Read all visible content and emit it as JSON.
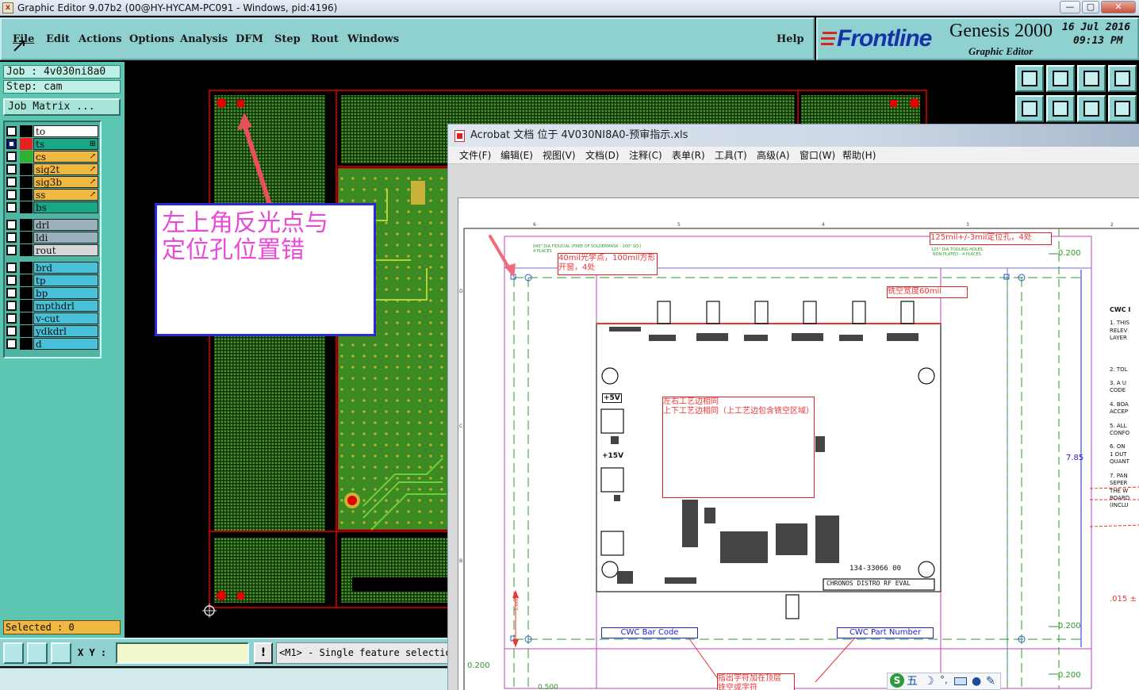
{
  "window": {
    "title": "Graphic Editor 9.07b2 (00@HY-HYCAM-PC091 - Windows, pid:4196)",
    "app_icon": "x-icon",
    "btn_minimize": "—",
    "btn_maximize": "▢",
    "btn_close": "✕"
  },
  "menu": {
    "items": [
      "File",
      "Edit",
      "Actions",
      "Options",
      "Analysis",
      "DFM",
      "Step",
      "Rout",
      "Windows"
    ],
    "help": "Help"
  },
  "logo": {
    "brand_first": "F",
    "brand_rest": "rontline",
    "product": "Genesis 2000",
    "subtitle": "Graphic Editor",
    "date": "16 Jul 2016",
    "time": "09:13 PM"
  },
  "job": {
    "job_label": "Job  : 4v030ni8a0",
    "step_label": "Step: cam",
    "matrix_button": "Job Matrix ..."
  },
  "layers": [
    {
      "name": "to",
      "color": "#ffffff",
      "swatch": "#000000",
      "checked": false,
      "mark": ""
    },
    {
      "name": "ts",
      "color": "#18a888",
      "swatch": "#e82020",
      "checked": true,
      "mark": "⊞"
    },
    {
      "name": "cs",
      "color": "#f0b840",
      "swatch": "#30b030",
      "checked": false,
      "mark": "↗"
    },
    {
      "name": "sig2t",
      "color": "#f0b840",
      "swatch": "#000000",
      "checked": false,
      "mark": "↗"
    },
    {
      "name": "sig3b",
      "color": "#f0b840",
      "swatch": "#000000",
      "checked": false,
      "mark": "↗"
    },
    {
      "name": "ss",
      "color": "#f0b840",
      "swatch": "#000000",
      "checked": false,
      "mark": "↗"
    },
    {
      "name": "bs",
      "color": "#18a888",
      "swatch": "#000000",
      "checked": false,
      "mark": ""
    },
    {
      "name": "drl",
      "color": "#9ab0bc",
      "swatch": "#000000",
      "checked": false,
      "mark": ""
    },
    {
      "name": "ldi",
      "color": "#9ab0bc",
      "swatch": "#000000",
      "checked": false,
      "mark": ""
    },
    {
      "name": "rout",
      "color": "#d8d8d8",
      "swatch": "#000000",
      "checked": false,
      "mark": ""
    },
    {
      "name": "brd",
      "color": "#48c0d8",
      "swatch": "#000000",
      "checked": false,
      "mark": ""
    },
    {
      "name": "tp",
      "color": "#48c0d8",
      "swatch": "#000000",
      "checked": false,
      "mark": ""
    },
    {
      "name": "bp",
      "color": "#48c0d8",
      "swatch": "#000000",
      "checked": false,
      "mark": ""
    },
    {
      "name": "mpthdrl",
      "color": "#48c0d8",
      "swatch": "#000000",
      "checked": false,
      "mark": ""
    },
    {
      "name": "v-cut",
      "color": "#48c0d8",
      "swatch": "#000000",
      "checked": false,
      "mark": ""
    },
    {
      "name": "ydkdrl",
      "color": "#48c0d8",
      "swatch": "#000000",
      "checked": false,
      "mark": ""
    },
    {
      "name": "d",
      "color": "#48c0d8",
      "swatch": "#000000",
      "checked": false,
      "mark": ""
    }
  ],
  "selected": "Selected : 0",
  "bottom": {
    "xy_label": "X Y :",
    "xy_value": "",
    "warn": "!",
    "message": "<M1> - Single feature selection"
  },
  "annotation": {
    "line1": "左上角反光点与",
    "line2": "定位孔位置错"
  },
  "acrobat": {
    "title": "Acrobat 文档 位于 4V030NI8A0-预审指示.xls",
    "menu": [
      "文件(F)",
      "编辑(E)",
      "视图(V)",
      "文档(D)",
      "注释(C)",
      "表单(R)",
      "工具(T)",
      "高级(A)",
      "窗口(W)",
      "帮助(H)"
    ]
  },
  "drawing": {
    "note_fiducial": "40mil光学点，100mil方形开窗，4处",
    "note_tooling": "125mil+/-3mil定位孔，4处",
    "note_millslot": "铣空宽度60mil",
    "note_edges": [
      "左右工艺边相同",
      "上下工艺边相同（上工艺边包含铣空区域）"
    ],
    "note_label": "指出字符加在顶层",
    "note_label2": "铣空或字符",
    "fid_small": "040\" DIA FIDUCIAL (FREE OF SOLDERMASK - 100\" SQ.)",
    "fid_small2": "4 PLACES",
    "tool_small": "125\" DIA TOOLING HOLES",
    "tool_small2": "NON PLATED - 4 PLACES",
    "dim_right": "7.85",
    "dim_top": "0.200",
    "dim_bottom1": "0.200",
    "dim_bottom2": "0.200",
    "dim_left": "0.200",
    "dim_left_small": "0.500",
    "dim_v_small": "1.000",
    "tol": ".015 ±",
    "board_id": "134-33066 00",
    "board_name": "CHRONOS DISTRO RF EVAL",
    "barcode": "CWC Bar Code",
    "partnum": "CWC Part Number",
    "v5": "+5V",
    "v15": "+15V",
    "col_marks": [
      "6",
      "5",
      "4",
      "3",
      "2"
    ],
    "row_marks": [
      "D",
      "C",
      "B"
    ],
    "side_notes": [
      "CWC I",
      "1. THIS",
      "RELEV",
      "LAYER",
      "2. TOL",
      "3. A U",
      "CODE",
      "4. BOA",
      "ACCEP",
      "5. ALL",
      "CONFO",
      "6. ON",
      "1 OUT",
      "QUANT",
      "7. PAN",
      "SEPER",
      "THE W",
      "BOARD",
      "(INCLU"
    ]
  },
  "ime": {
    "logo": "S",
    "mode": "五",
    "icons": [
      "moon-icon",
      "degree-icon",
      "keyboard-icon",
      "user-icon",
      "wrench-icon"
    ]
  },
  "colors": {
    "genesis_panel": "#8fd0d0",
    "layer_panel": "#5cc6b2",
    "pcb_green": "#3b8a22",
    "outline_red": "#e00000",
    "annot_magenta": "#e84ad8",
    "annot_blue": "#2a2ad8"
  }
}
